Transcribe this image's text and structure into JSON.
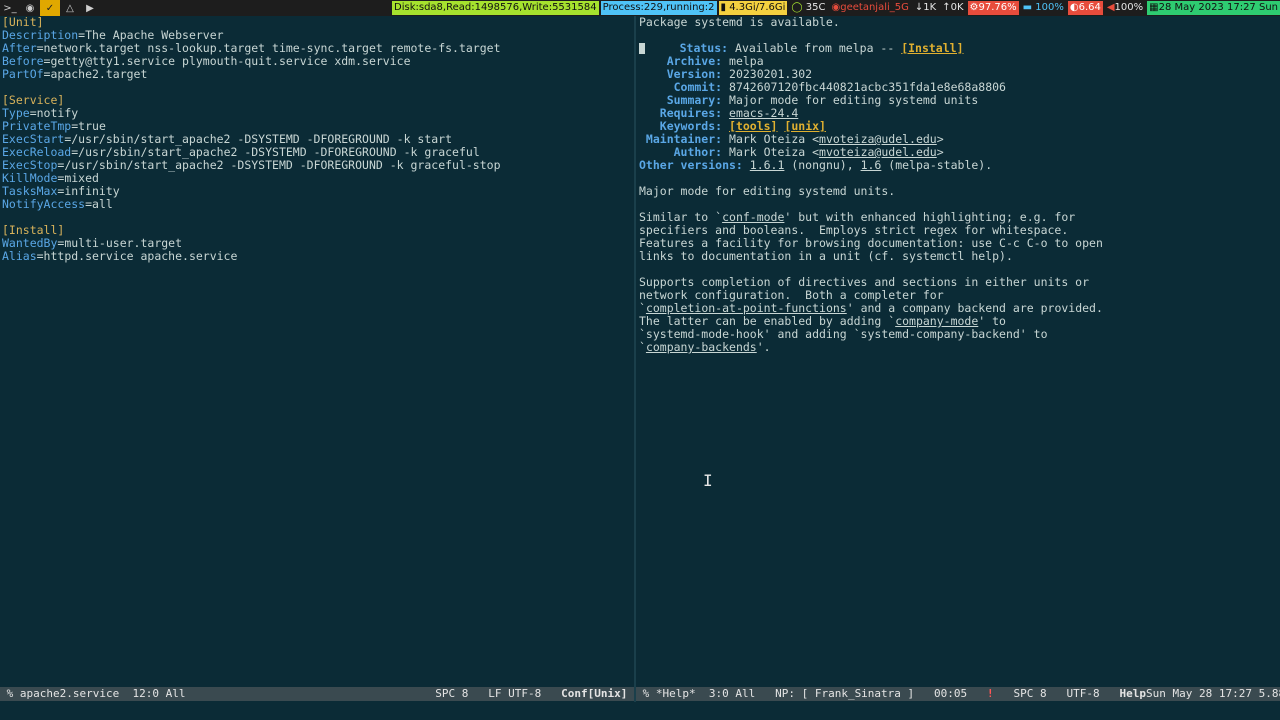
{
  "topbar": {
    "workspaces": [
      {
        "label": ">_",
        "icon": "terminal-icon"
      },
      {
        "label": "◉",
        "icon": "browser-icon"
      },
      {
        "label": "✓",
        "icon": "editor-icon"
      },
      {
        "label": "△",
        "icon": "linux-icon"
      },
      {
        "label": "▶",
        "icon": "video-icon"
      }
    ],
    "disk": "Disk:sda8,Read:1498576,Write:5531584",
    "process": "Process:229,running:2",
    "mem": "4.3Gi/7.6Gi",
    "temp": "35C",
    "wifi": "geetanjali_5G",
    "net_down": "1K",
    "net_up": "0K",
    "cpu": "97.76%",
    "battery": "100%",
    "load": "6.64",
    "volume": "100%",
    "datetime": "28 May 2023 17:27 Sun",
    "colors": {
      "disk": "#a6e22e",
      "process": "#4fc3f7",
      "mem": "#f4d03f",
      "cpu": "#e74c3c",
      "load": "#e74c3c",
      "datetime": "#2ecc71"
    }
  },
  "left": {
    "lines": [
      {
        "parts": [
          {
            "t": "[Unit]",
            "c": "sect"
          }
        ]
      },
      {
        "parts": [
          {
            "t": "Description",
            "c": "key"
          },
          {
            "t": "=The Apache Webserver",
            "c": "val"
          }
        ]
      },
      {
        "parts": [
          {
            "t": "After",
            "c": "key"
          },
          {
            "t": "=network.target nss-lookup.target time-sync.target remote-fs.target",
            "c": "val"
          }
        ]
      },
      {
        "parts": [
          {
            "t": "Before",
            "c": "key"
          },
          {
            "t": "=getty@tty1.service plymouth-quit.service xdm.service",
            "c": "val"
          }
        ]
      },
      {
        "parts": [
          {
            "t": "PartOf",
            "c": "key"
          },
          {
            "t": "=apache2.target",
            "c": "val"
          }
        ]
      },
      {
        "parts": []
      },
      {
        "parts": [
          {
            "t": "[Service]",
            "c": "sect"
          }
        ]
      },
      {
        "parts": [
          {
            "t": "Type",
            "c": "key"
          },
          {
            "t": "=notify",
            "c": "val"
          }
        ]
      },
      {
        "parts": [
          {
            "t": "PrivateTmp",
            "c": "key"
          },
          {
            "t": "=true",
            "c": "val"
          }
        ]
      },
      {
        "parts": [
          {
            "t": "ExecStart",
            "c": "key"
          },
          {
            "t": "=/usr/sbin/start_apache2 -DSYSTEMD -DFOREGROUND -k start",
            "c": "val"
          }
        ]
      },
      {
        "parts": [
          {
            "t": "ExecReload",
            "c": "key"
          },
          {
            "t": "=/usr/sbin/start_apache2 -DSYSTEMD -DFOREGROUND -k graceful",
            "c": "val"
          }
        ]
      },
      {
        "parts": [
          {
            "t": "ExecStop",
            "c": "key"
          },
          {
            "t": "=/usr/sbin/start_apache2 -DSYSTEMD -DFOREGROUND -k graceful-stop",
            "c": "val"
          }
        ]
      },
      {
        "parts": [
          {
            "t": "KillMode",
            "c": "key"
          },
          {
            "t": "=mixed",
            "c": "val"
          }
        ]
      },
      {
        "parts": [
          {
            "t": "TasksMax",
            "c": "key"
          },
          {
            "t": "=infinity",
            "c": "val"
          }
        ]
      },
      {
        "parts": [
          {
            "t": "NotifyAccess",
            "c": "key"
          },
          {
            "t": "=all",
            "c": "val"
          }
        ]
      },
      {
        "parts": []
      },
      {
        "parts": [
          {
            "t": "[Install]",
            "c": "sect"
          }
        ]
      },
      {
        "parts": [
          {
            "t": "WantedBy",
            "c": "key"
          },
          {
            "t": "=multi-user.target",
            "c": "val"
          }
        ]
      },
      {
        "parts": [
          {
            "t": "Alias",
            "c": "key"
          },
          {
            "t": "=httpd.service apache.service",
            "c": "val"
          }
        ]
      }
    ],
    "modeline": {
      "buffer": " % apache2.service",
      "position": "12:0 All",
      "indent": "SPC 8",
      "encoding": "LF UTF-8",
      "mode": "Conf[Unix]"
    }
  },
  "right": {
    "lines": [
      {
        "parts": [
          {
            "t": "Package systemd is available.",
            "c": "val"
          }
        ]
      },
      {
        "parts": []
      },
      {
        "cursor": true,
        "parts": [
          {
            "t": "     Status: ",
            "c": "rkey"
          },
          {
            "t": "Available from melpa -- ",
            "c": "val"
          },
          {
            "t": "[Install]",
            "c": "btn"
          }
        ]
      },
      {
        "parts": [
          {
            "t": "    Archive: ",
            "c": "rkey"
          },
          {
            "t": "melpa",
            "c": "val"
          }
        ]
      },
      {
        "parts": [
          {
            "t": "    Version: ",
            "c": "rkey"
          },
          {
            "t": "20230201.302",
            "c": "val"
          }
        ]
      },
      {
        "parts": [
          {
            "t": "     Commit: ",
            "c": "rkey"
          },
          {
            "t": "8742607120fbc440821acbc351fda1e8e68a8806",
            "c": "val"
          }
        ]
      },
      {
        "parts": [
          {
            "t": "    Summary: ",
            "c": "rkey"
          },
          {
            "t": "Major mode for editing systemd units",
            "c": "val"
          }
        ]
      },
      {
        "parts": [
          {
            "t": "   Requires: ",
            "c": "rkey"
          },
          {
            "t": "emacs-24.4",
            "c": "lnk"
          }
        ]
      },
      {
        "parts": [
          {
            "t": "   Keywords: ",
            "c": "rkey"
          },
          {
            "t": "[tools]",
            "c": "btn"
          },
          {
            "t": " ",
            "c": "val"
          },
          {
            "t": "[unix]",
            "c": "btn"
          }
        ]
      },
      {
        "parts": [
          {
            "t": " Maintainer: ",
            "c": "rkey"
          },
          {
            "t": "Mark Oteiza <",
            "c": "val"
          },
          {
            "t": "mvoteiza@udel.edu",
            "c": "lnk"
          },
          {
            "t": ">",
            "c": "val"
          }
        ]
      },
      {
        "parts": [
          {
            "t": "     Author: ",
            "c": "rkey"
          },
          {
            "t": "Mark Oteiza <",
            "c": "val"
          },
          {
            "t": "mvoteiza@udel.edu",
            "c": "lnk"
          },
          {
            "t": ">",
            "c": "val"
          }
        ]
      },
      {
        "parts": [
          {
            "t": "Other versions: ",
            "c": "rkey"
          },
          {
            "t": "1.6.1",
            "c": "lnk"
          },
          {
            "t": " (nongnu), ",
            "c": "val"
          },
          {
            "t": "1.6",
            "c": "lnk"
          },
          {
            "t": " (melpa-stable).",
            "c": "val"
          }
        ]
      },
      {
        "parts": []
      },
      {
        "parts": [
          {
            "t": "Major mode for editing systemd units.",
            "c": "val"
          }
        ]
      },
      {
        "parts": []
      },
      {
        "parts": [
          {
            "t": "Similar to `",
            "c": "val"
          },
          {
            "t": "conf-mode",
            "c": "lnk"
          },
          {
            "t": "' but with enhanced highlighting; e.g. for",
            "c": "val"
          }
        ]
      },
      {
        "parts": [
          {
            "t": "specifiers and booleans.  Employs strict regex for whitespace.",
            "c": "val"
          }
        ]
      },
      {
        "parts": [
          {
            "t": "Features a facility for browsing documentation: use C-c C-o to open",
            "c": "val"
          }
        ]
      },
      {
        "parts": [
          {
            "t": "links to documentation in a unit (cf. systemctl help).",
            "c": "val"
          }
        ]
      },
      {
        "parts": []
      },
      {
        "parts": [
          {
            "t": "Supports completion of directives and sections in either units or",
            "c": "val"
          }
        ]
      },
      {
        "parts": [
          {
            "t": "network configuration.  Both a completer for",
            "c": "val"
          }
        ]
      },
      {
        "parts": [
          {
            "t": "`",
            "c": "val"
          },
          {
            "t": "completion-at-point-functions",
            "c": "lnk"
          },
          {
            "t": "' and a company backend are provided.",
            "c": "val"
          }
        ]
      },
      {
        "parts": [
          {
            "t": "The latter can be enabled by adding `",
            "c": "val"
          },
          {
            "t": "company-mode",
            "c": "lnk"
          },
          {
            "t": "' to",
            "c": "val"
          }
        ]
      },
      {
        "parts": [
          {
            "t": "`systemd-mode-hook' and adding `systemd-company-backend' to",
            "c": "val"
          }
        ]
      },
      {
        "parts": [
          {
            "t": "`",
            "c": "val"
          },
          {
            "t": "company-backends",
            "c": "lnk"
          },
          {
            "t": "'.",
            "c": "val"
          }
        ]
      }
    ],
    "modeline": {
      "buffer": " % *Help*",
      "position": "3:0 All",
      "music": "NP: [ Frank_Sinatra ]",
      "time": "00:05",
      "alert": "!",
      "indent": "SPC 8",
      "encoding": "UTF-8",
      "mode": "Help",
      "clock": "Sun May 28 17:27 5.88"
    }
  }
}
